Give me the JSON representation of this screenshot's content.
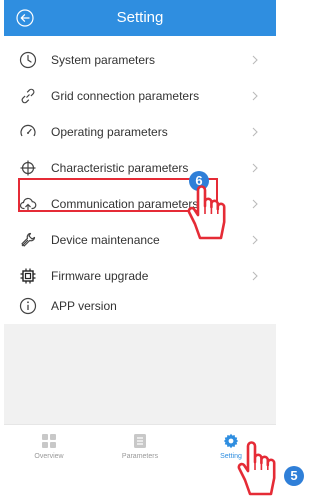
{
  "header": {
    "title": "Setting",
    "back_icon": "back-arrow-circle-icon"
  },
  "menu": [
    {
      "label": "System parameters",
      "icon": "clock-icon"
    },
    {
      "label": "Grid connection parameters",
      "icon": "link-icon"
    },
    {
      "label": "Operating parameters",
      "icon": "gauge-icon"
    },
    {
      "label": "Characteristic parameters",
      "icon": "crosshair-icon"
    },
    {
      "label": "Communication parameters",
      "icon": "cloud-upload-icon"
    },
    {
      "label": "Device maintenance",
      "icon": "wrench-icon"
    },
    {
      "label": "Firmware upgrade",
      "icon": "chip-icon"
    },
    {
      "label": "APP version",
      "icon": "info-icon"
    }
  ],
  "tabs": [
    {
      "label": "Overview",
      "icon": "grid-icon",
      "active": false
    },
    {
      "label": "Parameters",
      "icon": "list-icon",
      "active": false
    },
    {
      "label": "Setting",
      "icon": "gear-icon",
      "active": true
    }
  ],
  "callouts": {
    "step_menu": "6",
    "step_tab": "5"
  },
  "colors": {
    "header": "#2f8ee0",
    "highlight": "#e52b36",
    "badge": "#2f7fd8",
    "active_tab": "#2f8ee0"
  }
}
